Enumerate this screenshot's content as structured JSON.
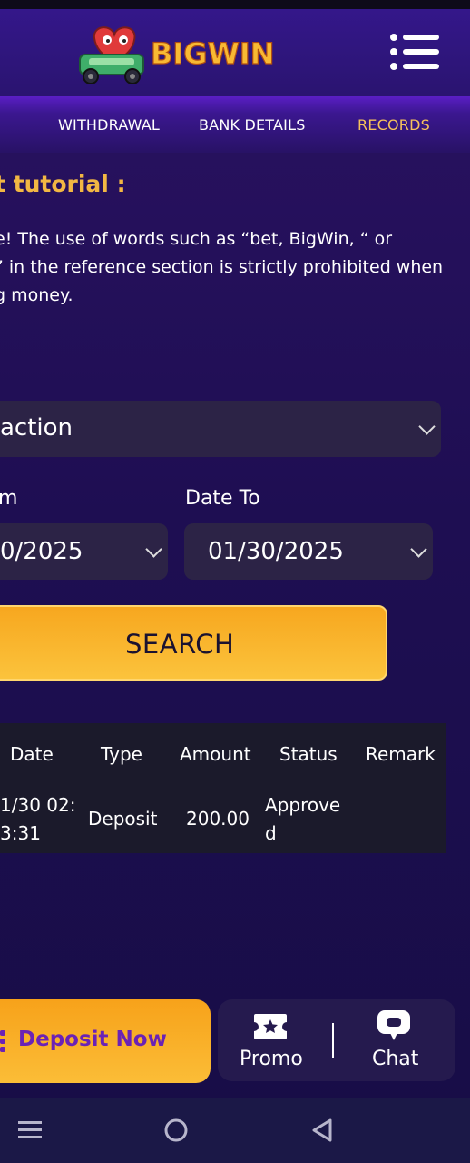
{
  "app": {
    "brand": "BIGWIN"
  },
  "tabs": [
    {
      "label": "WITHDRAWAL"
    },
    {
      "label": "BANK DETAILS"
    },
    {
      "label": "RECORDS"
    }
  ],
  "tutorial": {
    "title": "t tutorial :",
    "lines": [
      "e! The use of words such as “bet, BigWin, “ or",
      "” in the reference section is strictly prohibited when",
      "g money."
    ]
  },
  "filters": {
    "transaction_select": "action",
    "date_from_label": "m",
    "date_from_value": "0/2025",
    "date_to_label": "Date To",
    "date_to_value": "01/30/2025",
    "search_label": "SEARCH"
  },
  "table": {
    "headers": [
      "Date",
      "Type",
      "Amount",
      "Status",
      "Remark"
    ],
    "rows": [
      {
        "date_line1": "1/30 02:",
        "date_line2": "3:31",
        "type": "Deposit",
        "amount": "200.00",
        "status_line1": "Approve",
        "status_line2": "d",
        "remark": ""
      }
    ]
  },
  "bottom_nav": {
    "deposit_label": "Deposit Now",
    "promo_label": "Promo",
    "chat_label": "Chat"
  },
  "colors": {
    "accent": "#f6c15c",
    "button": "#f7a71f",
    "background": "#1e0e52"
  }
}
